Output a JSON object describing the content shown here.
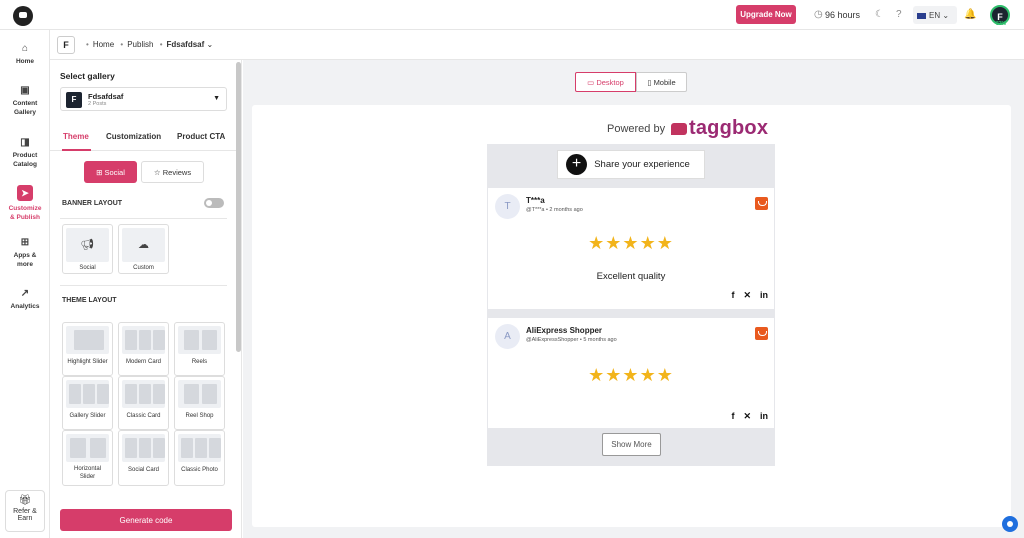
{
  "topbar": {
    "upgrade_label": "Upgrade Now",
    "hours": "96 hours",
    "language": "EN",
    "user_initial": "F",
    "progress": "33%"
  },
  "nav": {
    "items": [
      {
        "label": "Home"
      },
      {
        "label": "Content Gallery"
      },
      {
        "label": "Product Catalog"
      },
      {
        "label": "Customize & Publish"
      },
      {
        "label": "Apps & more"
      },
      {
        "label": "Analytics"
      }
    ],
    "refer_label": "Refer & Earn"
  },
  "breadcrumb": {
    "badge": "F",
    "home": "Home",
    "publish": "Publish",
    "current": "Fdsafdsaf"
  },
  "panel": {
    "select_gallery_label": "Select gallery",
    "gallery_badge": "F",
    "gallery_name": "Fdsafdsaf",
    "gallery_posts": "2 Posts",
    "tabs": [
      "Theme",
      "Customization",
      "Product CTA"
    ],
    "social_label": "Social",
    "reviews_label": "Reviews",
    "banner_layout_label": "BANNER LAYOUT",
    "banner_options": [
      "Social",
      "Custom"
    ],
    "theme_layout_label": "THEME LAYOUT",
    "theme_layouts": [
      "Highlight Slider",
      "Modern Card",
      "Reels",
      "Gallery Slider",
      "Classic Card",
      "Reel Shop",
      "Horizontal Slider",
      "Social Card",
      "Classic Photo"
    ],
    "generate_label": "Generate code"
  },
  "preview": {
    "desktop_label": "Desktop",
    "mobile_label": "Mobile",
    "powered_by": "Powered by",
    "brand": "taggbox",
    "share_label": "Share your experience",
    "posts": [
      {
        "avatar": "T",
        "name": "T***a",
        "handle": "@T***a",
        "time": "2 months ago",
        "stars": "★★★★★",
        "text": "Excellent quality"
      },
      {
        "avatar": "A",
        "name": "AliExpress Shopper",
        "handle": "@AliExpressShopper",
        "time": "5 months ago",
        "stars": "★★★★★",
        "text": ""
      }
    ],
    "show_more_label": "Show More"
  }
}
